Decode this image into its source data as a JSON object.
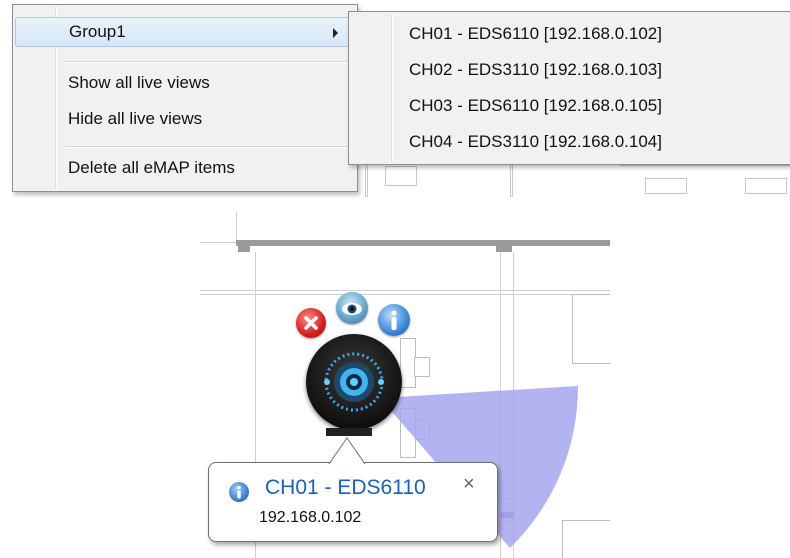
{
  "context_menu": {
    "items": [
      {
        "label": "Group1",
        "has_submenu": true
      },
      {
        "label": "Show all live views"
      },
      {
        "label": "Hide all live views"
      },
      {
        "label": "Delete all eMAP items"
      }
    ]
  },
  "submenu": {
    "items": [
      {
        "label": "CH01 - EDS6110 [192.168.0.102]"
      },
      {
        "label": "CH02 - EDS3110 [192.168.0.103]"
      },
      {
        "label": "CH03 - EDS6110 [192.168.0.105]"
      },
      {
        "label": "CH04 - EDS3110 [192.168.0.104]"
      }
    ]
  },
  "camera_tooltip": {
    "title": "CH01 - EDS6110",
    "ip": "192.168.0.102",
    "close_glyph": "×"
  },
  "camera_actions": {
    "delete_icon": "delete-icon",
    "live_view_icon": "eye-icon",
    "info_icon": "info-icon"
  },
  "colors": {
    "menu_bg": "#f1f1f1",
    "highlight": "#d6e6f8",
    "fov": "#a7a6f0",
    "tooltip_title": "#1f5fb4"
  }
}
